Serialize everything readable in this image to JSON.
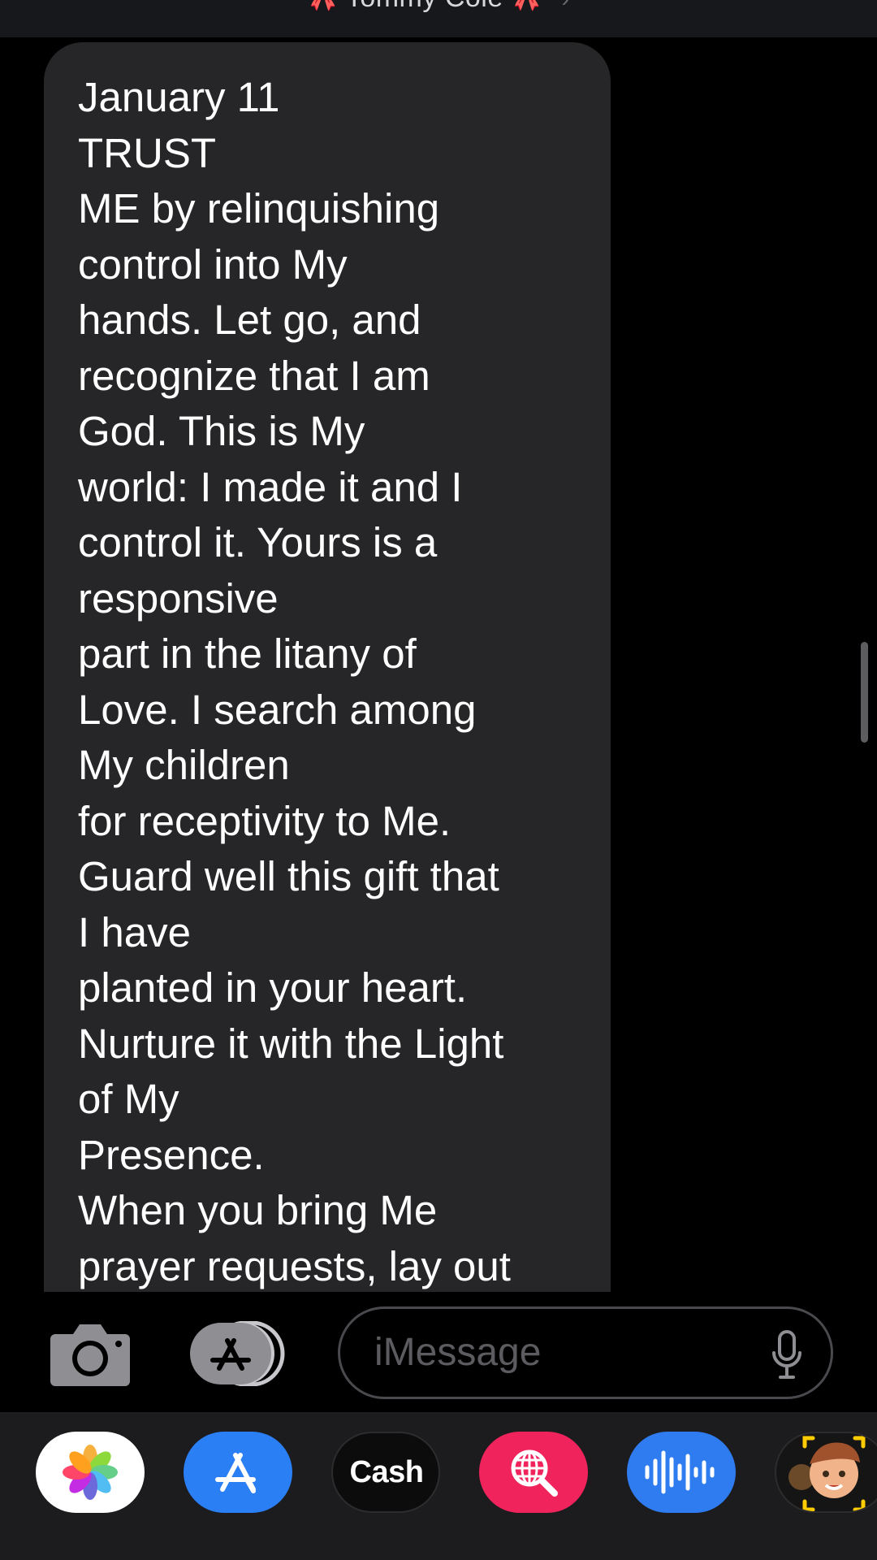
{
  "header": {
    "contact_name": "Tommy Cole",
    "emoji_left": "🎀",
    "emoji_right": "🎀"
  },
  "message": {
    "direction": "incoming",
    "lines": [
      "January 11",
      "TRUST",
      "ME by relinquishing",
      "control into My",
      "hands. Let go, and",
      "recognize that I am",
      "God. This is My",
      "world: I made it and I",
      "control it. Yours is a",
      "responsive",
      "part in the litany of",
      "Love. I search among",
      "My children",
      "for receptivity to Me.",
      "Guard well this gift that",
      "I have",
      "planted in your heart.",
      "Nurture it with the Light",
      "of My",
      "Presence.",
      "When you bring Me",
      "prayer requests, lay out"
    ]
  },
  "composer": {
    "placeholder": "iMessage",
    "camera_icon": "camera-icon",
    "apps_icon": "app-store-icon",
    "mic_icon": "microphone-icon"
  },
  "app_drawer": {
    "apps": [
      {
        "name": "Photos",
        "icon": "photos-icon"
      },
      {
        "name": "App Store",
        "icon": "app-store-icon"
      },
      {
        "name": "Apple Cash",
        "icon": "apple-cash-icon",
        "label": "Cash"
      },
      {
        "name": "Image Search",
        "icon": "globe-search-icon"
      },
      {
        "name": "Audio Message",
        "icon": "waveform-icon"
      },
      {
        "name": "Memoji",
        "icon": "memoji-icon"
      }
    ]
  },
  "colors": {
    "background": "#000000",
    "bubble": "#262628",
    "text": "#ffffff",
    "placeholder": "#5c5c60",
    "accent_blue": "#2a7ff5",
    "accent_pink": "#f0235c"
  }
}
